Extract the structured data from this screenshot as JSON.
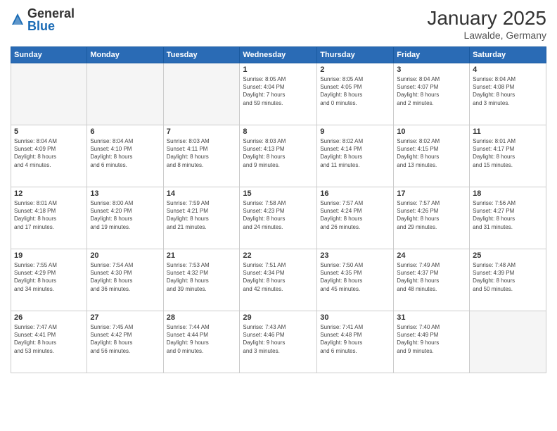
{
  "header": {
    "logo": {
      "general": "General",
      "blue": "Blue"
    },
    "title": "January 2025",
    "location": "Lawalde, Germany"
  },
  "weekdays": [
    "Sunday",
    "Monday",
    "Tuesday",
    "Wednesday",
    "Thursday",
    "Friday",
    "Saturday"
  ],
  "weeks": [
    [
      {
        "day": "",
        "info": ""
      },
      {
        "day": "",
        "info": ""
      },
      {
        "day": "",
        "info": ""
      },
      {
        "day": "1",
        "info": "Sunrise: 8:05 AM\nSunset: 4:04 PM\nDaylight: 7 hours\nand 59 minutes."
      },
      {
        "day": "2",
        "info": "Sunrise: 8:05 AM\nSunset: 4:05 PM\nDaylight: 8 hours\nand 0 minutes."
      },
      {
        "day": "3",
        "info": "Sunrise: 8:04 AM\nSunset: 4:07 PM\nDaylight: 8 hours\nand 2 minutes."
      },
      {
        "day": "4",
        "info": "Sunrise: 8:04 AM\nSunset: 4:08 PM\nDaylight: 8 hours\nand 3 minutes."
      }
    ],
    [
      {
        "day": "5",
        "info": "Sunrise: 8:04 AM\nSunset: 4:09 PM\nDaylight: 8 hours\nand 4 minutes."
      },
      {
        "day": "6",
        "info": "Sunrise: 8:04 AM\nSunset: 4:10 PM\nDaylight: 8 hours\nand 6 minutes."
      },
      {
        "day": "7",
        "info": "Sunrise: 8:03 AM\nSunset: 4:11 PM\nDaylight: 8 hours\nand 8 minutes."
      },
      {
        "day": "8",
        "info": "Sunrise: 8:03 AM\nSunset: 4:13 PM\nDaylight: 8 hours\nand 9 minutes."
      },
      {
        "day": "9",
        "info": "Sunrise: 8:02 AM\nSunset: 4:14 PM\nDaylight: 8 hours\nand 11 minutes."
      },
      {
        "day": "10",
        "info": "Sunrise: 8:02 AM\nSunset: 4:15 PM\nDaylight: 8 hours\nand 13 minutes."
      },
      {
        "day": "11",
        "info": "Sunrise: 8:01 AM\nSunset: 4:17 PM\nDaylight: 8 hours\nand 15 minutes."
      }
    ],
    [
      {
        "day": "12",
        "info": "Sunrise: 8:01 AM\nSunset: 4:18 PM\nDaylight: 8 hours\nand 17 minutes."
      },
      {
        "day": "13",
        "info": "Sunrise: 8:00 AM\nSunset: 4:20 PM\nDaylight: 8 hours\nand 19 minutes."
      },
      {
        "day": "14",
        "info": "Sunrise: 7:59 AM\nSunset: 4:21 PM\nDaylight: 8 hours\nand 21 minutes."
      },
      {
        "day": "15",
        "info": "Sunrise: 7:58 AM\nSunset: 4:23 PM\nDaylight: 8 hours\nand 24 minutes."
      },
      {
        "day": "16",
        "info": "Sunrise: 7:57 AM\nSunset: 4:24 PM\nDaylight: 8 hours\nand 26 minutes."
      },
      {
        "day": "17",
        "info": "Sunrise: 7:57 AM\nSunset: 4:26 PM\nDaylight: 8 hours\nand 29 minutes."
      },
      {
        "day": "18",
        "info": "Sunrise: 7:56 AM\nSunset: 4:27 PM\nDaylight: 8 hours\nand 31 minutes."
      }
    ],
    [
      {
        "day": "19",
        "info": "Sunrise: 7:55 AM\nSunset: 4:29 PM\nDaylight: 8 hours\nand 34 minutes."
      },
      {
        "day": "20",
        "info": "Sunrise: 7:54 AM\nSunset: 4:30 PM\nDaylight: 8 hours\nand 36 minutes."
      },
      {
        "day": "21",
        "info": "Sunrise: 7:53 AM\nSunset: 4:32 PM\nDaylight: 8 hours\nand 39 minutes."
      },
      {
        "day": "22",
        "info": "Sunrise: 7:51 AM\nSunset: 4:34 PM\nDaylight: 8 hours\nand 42 minutes."
      },
      {
        "day": "23",
        "info": "Sunrise: 7:50 AM\nSunset: 4:35 PM\nDaylight: 8 hours\nand 45 minutes."
      },
      {
        "day": "24",
        "info": "Sunrise: 7:49 AM\nSunset: 4:37 PM\nDaylight: 8 hours\nand 48 minutes."
      },
      {
        "day": "25",
        "info": "Sunrise: 7:48 AM\nSunset: 4:39 PM\nDaylight: 8 hours\nand 50 minutes."
      }
    ],
    [
      {
        "day": "26",
        "info": "Sunrise: 7:47 AM\nSunset: 4:41 PM\nDaylight: 8 hours\nand 53 minutes."
      },
      {
        "day": "27",
        "info": "Sunrise: 7:45 AM\nSunset: 4:42 PM\nDaylight: 8 hours\nand 56 minutes."
      },
      {
        "day": "28",
        "info": "Sunrise: 7:44 AM\nSunset: 4:44 PM\nDaylight: 9 hours\nand 0 minutes."
      },
      {
        "day": "29",
        "info": "Sunrise: 7:43 AM\nSunset: 4:46 PM\nDaylight: 9 hours\nand 3 minutes."
      },
      {
        "day": "30",
        "info": "Sunrise: 7:41 AM\nSunset: 4:48 PM\nDaylight: 9 hours\nand 6 minutes."
      },
      {
        "day": "31",
        "info": "Sunrise: 7:40 AM\nSunset: 4:49 PM\nDaylight: 9 hours\nand 9 minutes."
      },
      {
        "day": "",
        "info": ""
      }
    ]
  ]
}
